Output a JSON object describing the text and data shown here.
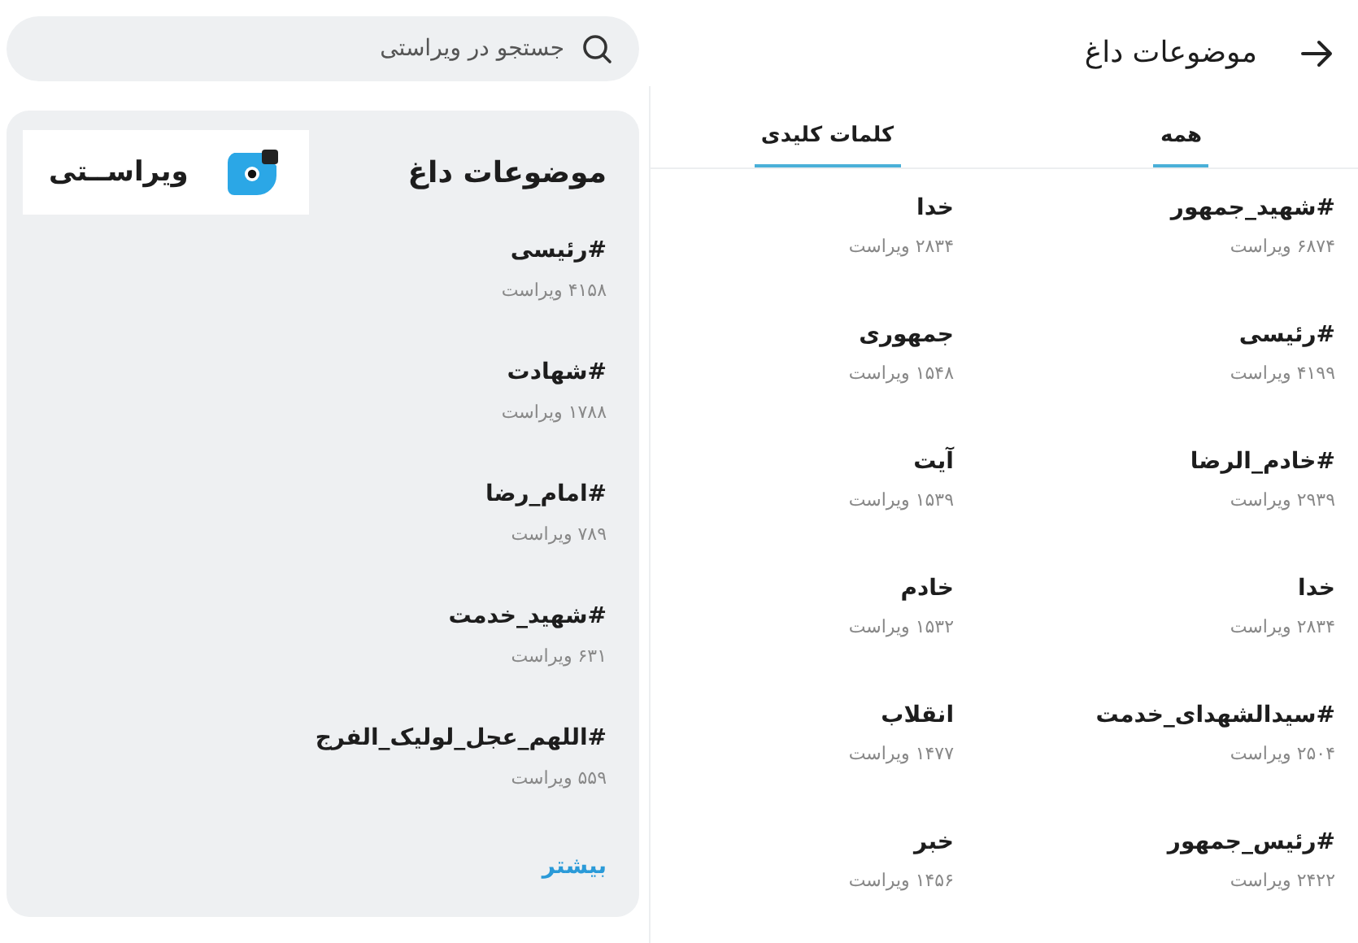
{
  "header": {
    "title": "موضوعات داغ"
  },
  "tabs": [
    {
      "label": "همه",
      "selected": true
    },
    {
      "label": "کلمات کلیدی",
      "selected": true
    }
  ],
  "columns": [
    {
      "items": [
        {
          "tag": "#شهید_جمهور",
          "count": "۶۸۷۴ ویراست"
        },
        {
          "tag": "#رئیسی",
          "count": "۴۱۹۹ ویراست"
        },
        {
          "tag": "#خادم_الرضا",
          "count": "۲۹۳۹ ویراست"
        },
        {
          "tag": "خدا",
          "count": "۲۸۳۴ ویراست"
        },
        {
          "tag": "#سیدالشهدای_خدمت",
          "count": "۲۵۰۴ ویراست"
        },
        {
          "tag": "#رئیس_جمهور",
          "count": "۲۴۲۲ ویراست"
        }
      ]
    },
    {
      "items": [
        {
          "tag": "خدا",
          "count": "۲۸۳۴ ویراست"
        },
        {
          "tag": "جمهوری",
          "count": "۱۵۴۸ ویراست"
        },
        {
          "tag": "آیت",
          "count": "۱۵۳۹ ویراست"
        },
        {
          "tag": "خادم",
          "count": "۱۵۳۲ ویراست"
        },
        {
          "tag": "انقلاب",
          "count": "۱۴۷۷ ویراست"
        },
        {
          "tag": "خبر",
          "count": "۱۴۵۶ ویراست"
        }
      ]
    }
  ],
  "search": {
    "placeholder": "جستجو در ویراستی"
  },
  "card": {
    "title": "موضوعات داغ",
    "logo": "ویراســتی",
    "items": [
      {
        "tag": "#رئیسی",
        "count": "۴۱۵۸ ویراست"
      },
      {
        "tag": "#شهادت",
        "count": "۱۷۸۸ ویراست"
      },
      {
        "tag": "#امام_رضا",
        "count": "۷۸۹ ویراست"
      },
      {
        "tag": "#شهید_خدمت",
        "count": "۶۳۱ ویراست"
      },
      {
        "tag": "#اللهم_عجل_لولیک_الفرج",
        "count": "۵۵۹ ویراست"
      }
    ],
    "more": "بیشتر"
  }
}
